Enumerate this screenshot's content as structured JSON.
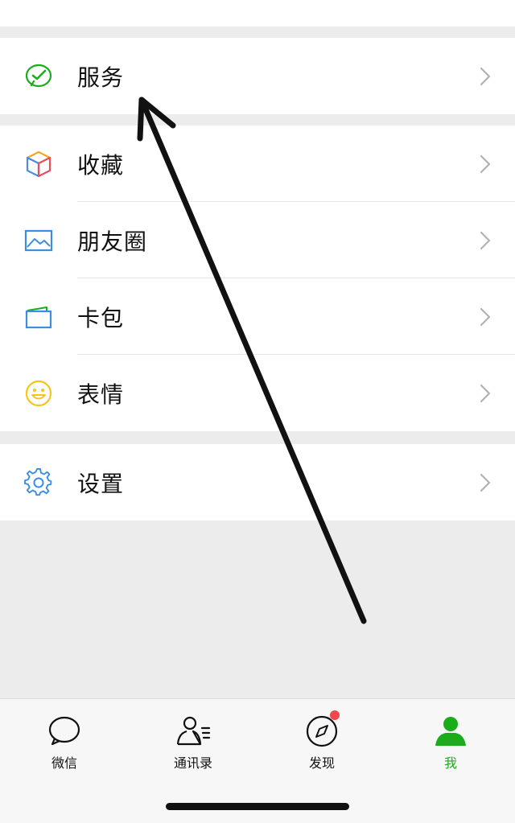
{
  "menu": {
    "services": {
      "label": "服务",
      "icon": "wechat-pay-icon"
    },
    "favorites": {
      "label": "收藏",
      "icon": "cube-icon"
    },
    "moments": {
      "label": "朋友圈",
      "icon": "picture-icon"
    },
    "cards": {
      "label": "卡包",
      "icon": "wallet-icon"
    },
    "stickers": {
      "label": "表情",
      "icon": "smiley-icon"
    },
    "settings": {
      "label": "设置",
      "icon": "gear-icon"
    }
  },
  "tabbar": {
    "chats": "微信",
    "contacts": "通讯录",
    "discover": "发现",
    "me": "我"
  },
  "colors": {
    "accent_green": "#1aad19",
    "badge_red": "#f04848",
    "background": "#ececec"
  }
}
